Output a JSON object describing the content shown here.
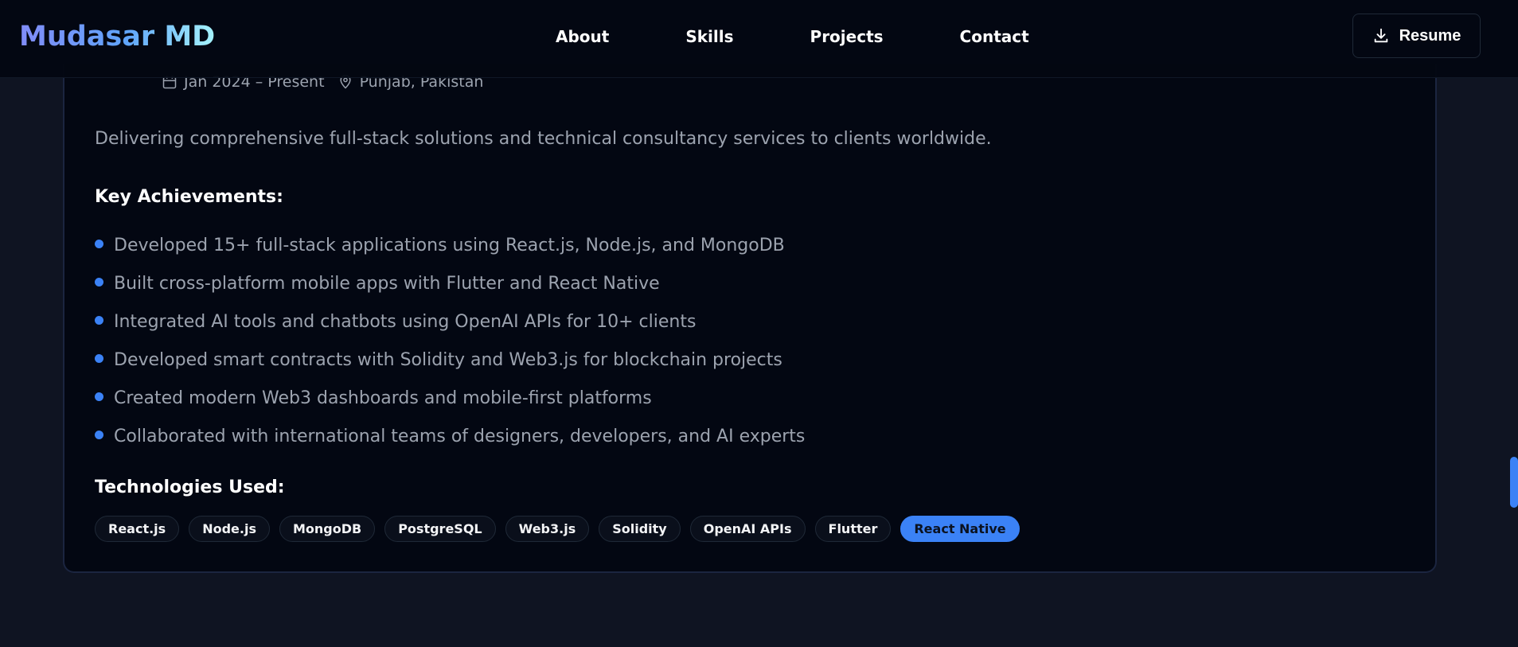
{
  "header": {
    "logo": "Mudasar MD",
    "nav": [
      "About",
      "Skills",
      "Projects",
      "Contact"
    ],
    "resume_label": "Resume"
  },
  "job": {
    "date": "Jan 2024 – Present",
    "location": "Punjab, Pakistan",
    "description": "Delivering comprehensive full-stack solutions and technical consultancy services to clients worldwide.",
    "achievements_heading": "Key Achievements:",
    "achievements": [
      "Developed 15+ full-stack applications using React.js, Node.js, and MongoDB",
      "Built cross-platform mobile apps with Flutter and React Native",
      "Integrated AI tools and chatbots using OpenAI APIs for 10+ clients",
      "Developed smart contracts with Solidity and Web3.js for blockchain projects",
      "Created modern Web3 dashboards and mobile-first platforms",
      "Collaborated with international teams of designers, developers, and AI experts"
    ],
    "technologies_heading": "Technologies Used:",
    "technologies": [
      "React.js",
      "Node.js",
      "MongoDB",
      "PostgreSQL",
      "Web3.js",
      "Solidity",
      "OpenAI APIs",
      "Flutter",
      "React Native"
    ],
    "highlighted_technology": "React Native"
  },
  "colors": {
    "accent": "#3b82f6",
    "background": "#0f1422",
    "card": "#030712"
  }
}
